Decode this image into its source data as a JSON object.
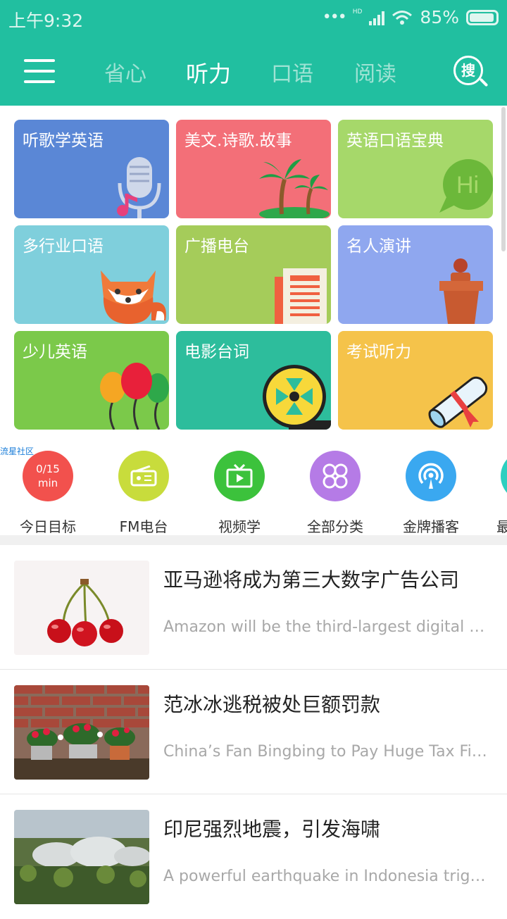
{
  "status_bar": {
    "time": "上午9:32",
    "battery": "85%",
    "network": "HD"
  },
  "nav": {
    "tabs": [
      {
        "label": "省心",
        "active": false
      },
      {
        "label": "听力",
        "active": true
      },
      {
        "label": "口语",
        "active": false
      },
      {
        "label": "阅读",
        "active": false
      }
    ],
    "search_label": "搜"
  },
  "categories": [
    {
      "label": "听歌学英语",
      "color": "#5a87d6",
      "icon": "microphone-music-icon"
    },
    {
      "label": "美文.诗歌.故事",
      "color": "#f36f78",
      "icon": "palm-tree-icon"
    },
    {
      "label": "英语口语宝典",
      "color": "#a6d86a",
      "icon": "speech-bubble-hi-icon",
      "icon_text": "Hi"
    },
    {
      "label": "多行业口语",
      "color": "#7fcfdc",
      "icon": "fox-icon"
    },
    {
      "label": "广播电台",
      "color": "#a5cc5a",
      "icon": "newspaper-icon"
    },
    {
      "label": "名人演讲",
      "color": "#8fa7ef",
      "icon": "podium-icon"
    },
    {
      "label": "少儿英语",
      "color": "#7bc94a",
      "icon": "balloons-icon"
    },
    {
      "label": "电影台词",
      "color": "#2dbd9c",
      "icon": "film-reel-icon"
    },
    {
      "label": "考试听力",
      "color": "#f5c34a",
      "icon": "diploma-icon"
    }
  ],
  "community_tag": "流星社区",
  "shortcuts": [
    {
      "label": "今日目标",
      "color": "#f2514d",
      "icon": "goal-progress-icon",
      "value": "0/15",
      "unit": "min"
    },
    {
      "label": "FM电台",
      "color": "#c8dc3c",
      "icon": "radio-icon"
    },
    {
      "label": "视频学",
      "color": "#3cc23c",
      "icon": "tv-icon"
    },
    {
      "label": "全部分类",
      "color": "#b57be6",
      "icon": "grid-clover-icon"
    },
    {
      "label": "金牌播客",
      "color": "#3aa8f0",
      "icon": "podcast-icon"
    },
    {
      "label": "最",
      "color": "#2dcfc0",
      "icon": "more-icon"
    }
  ],
  "articles": [
    {
      "title": "亚马逊将成为第三大数字广告公司",
      "subtitle": "Amazon will be the third-largest digital AD...",
      "thumb": "cherries-image"
    },
    {
      "title": "范冰冰逃税被处巨额罚款",
      "subtitle": "China’s Fan Bingbing to Pay Huge Tax Fine",
      "thumb": "flower-pots-image"
    },
    {
      "title": "印尼强烈地震，引发海啸",
      "subtitle": "A powerful earthquake in Indonesia trigge...",
      "thumb": "domes-landscape-image"
    }
  ]
}
